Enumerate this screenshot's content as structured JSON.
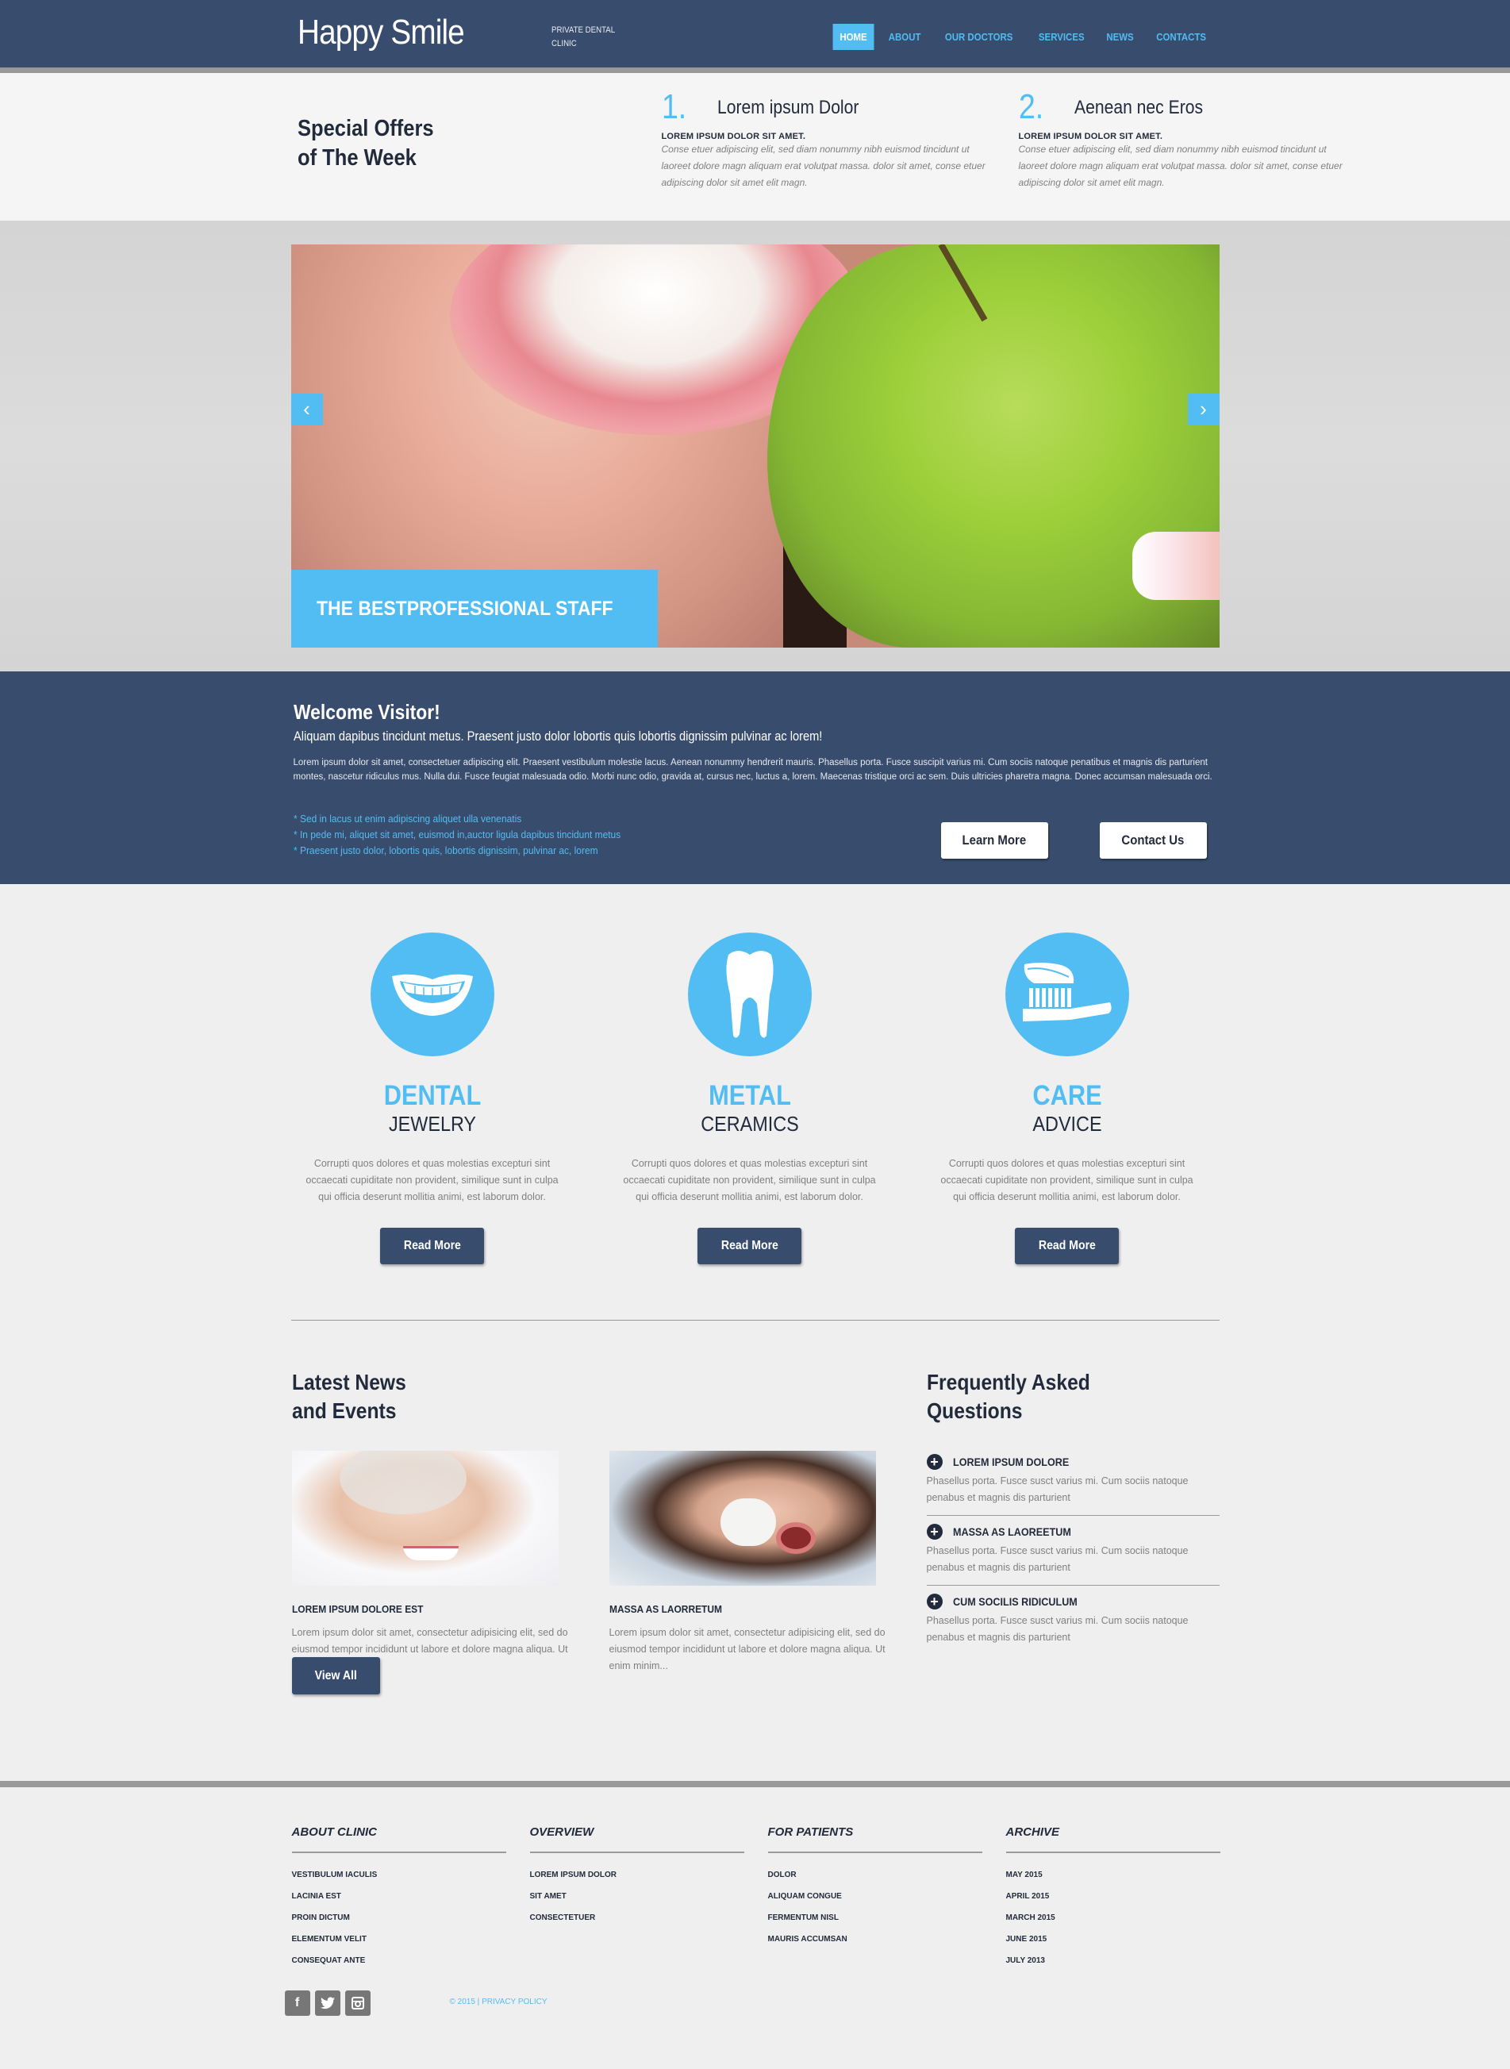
{
  "header": {
    "logo": "Happy Smile",
    "tagline": "PRIVATE DENTAL CLINIC",
    "nav": [
      {
        "label": "HOME",
        "active": true
      },
      {
        "label": "ABOUT"
      },
      {
        "label": "OUR DOCTORS"
      },
      {
        "label": "SERVICES"
      },
      {
        "label": "NEWS"
      },
      {
        "label": "CONTACTS"
      }
    ]
  },
  "offers": {
    "title_line1": "Special Offers",
    "title_line2": "of The Week",
    "items": [
      {
        "number": "1.",
        "title": "Lorem ipsum Dolor",
        "subtitle": "LOREM IPSUM DOLOR SIT AMET.",
        "text": "Conse etuer adipiscing elit, sed diam nonummy nibh euismod tincidunt ut laoreet dolore magn aliquam erat volutpat massa. dolor sit amet, conse etuer adipiscing dolor sit amet elit magn."
      },
      {
        "number": "2.",
        "title": "Aenean nec Eros",
        "subtitle": "LOREM IPSUM DOLOR SIT AMET.",
        "text": "Conse etuer adipiscing elit, sed diam nonummy nibh euismod tincidunt ut laoreet dolore magn aliquam erat volutpat massa. dolor sit amet, conse etuer adipiscing dolor sit amet elit magn."
      }
    ]
  },
  "slider": {
    "caption": "THE BESTPROFESSIONAL STAFF",
    "prev_icon": "chevron-left-icon",
    "next_icon": "chevron-right-icon"
  },
  "welcome": {
    "title": "Welcome Visitor!",
    "lead": "Aliquam dapibus tincidunt metus. Praesent justo dolor lobortis quis lobortis dignissim pulvinar ac lorem!",
    "body": "Lorem ipsum dolor sit amet, consectetuer adipiscing elit. Praesent vestibulum molestie lacus. Aenean nonummy hendrerit mauris. Phasellus porta. Fusce suscipit varius mi. Cum sociis natoque penatibus et magnis dis parturient montes, nascetur ridiculus mus. Nulla dui. Fusce feugiat malesuada odio. Morbi nunc odio, gravida at, cursus nec, luctus a, lorem. Maecenas tristique orci ac sem. Duis ultricies pharetra magna. Donec accumsan malesuada orci.",
    "bullets": [
      "* Sed in lacus ut enim adipiscing aliquet ulla venenatis",
      "* In pede mi, aliquet sit amet, euismod in,auctor ligula dapibus tincidunt metus",
      "* Praesent justo dolor, lobortis quis, lobortis dignissim, pulvinar ac, lorem"
    ],
    "learn_more": "Learn More",
    "contact_us": "Contact Us"
  },
  "services": [
    {
      "icon": "smile-icon",
      "title": "DENTAL",
      "subtitle": "JEWELRY",
      "text": "Corrupti quos dolores et quas molestias excepturi sint occaecati cupiditate non provident, similique sunt in culpa qui officia deserunt mollitia animi, est laborum dolor.",
      "button": "Read More"
    },
    {
      "icon": "tooth-icon",
      "title": "METAL",
      "subtitle": "CERAMICS",
      "text": "Corrupti quos dolores et quas molestias excepturi sint occaecati cupiditate non provident, similique sunt in culpa qui officia deserunt mollitia animi, est laborum dolor.",
      "button": "Read More"
    },
    {
      "icon": "toothbrush-icon",
      "title": "CARE",
      "subtitle": "ADVICE",
      "text": "Corrupti quos dolores et quas molestias excepturi sint occaecati cupiditate non provident, similique sunt in culpa qui officia deserunt mollitia animi, est laborum dolor.",
      "button": "Read More"
    }
  ],
  "news": {
    "title_line1": "Latest News",
    "title_line2": "and Events",
    "items": [
      {
        "title": "LOREM IPSUM DOLORE EST",
        "text": "Lorem ipsum dolor sit amet, consectetur adipisicing elit, sed do eiusmod tempor incididunt ut labore et dolore magna aliqua. Ut enim minim..."
      },
      {
        "title": "MASSA AS LAORRETUM",
        "text": "Lorem ipsum dolor sit amet, consectetur adipisicing elit, sed do eiusmod tempor incididunt ut labore et dolore magna aliqua. Ut enim minim..."
      }
    ],
    "view_all": "View All"
  },
  "faq": {
    "title_line1": "Frequently Asked",
    "title_line2": "Questions",
    "items": [
      {
        "q": "LOREM IPSUM DOLORE",
        "a": "Phasellus porta. Fusce susct varius mi. Cum sociis natoque penabus et magnis dis parturient"
      },
      {
        "q": "MASSA AS LAOREETUM",
        "a": "Phasellus porta. Fusce susct varius mi. Cum sociis natoque penabus et magnis dis parturient"
      },
      {
        "q": "CUM SOCILIS RIDICULUM",
        "a": "Phasellus porta. Fusce susct varius mi. Cum sociis natoque penabus et magnis dis parturient"
      }
    ]
  },
  "footer": {
    "columns": [
      {
        "title": "ABOUT CLINIC",
        "links": [
          "VESTIBULUM IACULIS",
          "LACINIA EST",
          "PROIN DICTUM",
          "ELEMENTUM VELIT",
          "CONSEQUAT ANTE"
        ]
      },
      {
        "title": "OVERVIEW",
        "links": [
          "LOREM IPSUM DOLOR",
          "SIT AMET",
          "CONSECTETUER"
        ]
      },
      {
        "title": "FOR PATIENTS",
        "links": [
          "DOLOR",
          "ALIQUAM CONGUE",
          "FERMENTUM NISL",
          "MAURIS ACCUMSAN"
        ]
      },
      {
        "title": "ARCHIVE",
        "links": [
          "MAY 2015",
          "APRIL 2015",
          "MARCH 2015",
          "JUNE 2015",
          "JULY 2013"
        ]
      }
    ],
    "social": [
      {
        "icon": "facebook-icon",
        "glyph": "f"
      },
      {
        "icon": "twitter-icon",
        "glyph": "t"
      },
      {
        "icon": "instagram-icon",
        "glyph": "◙"
      }
    ],
    "copyright": "© 2015 |",
    "privacy": "PRIVACY POLICY"
  },
  "colors": {
    "primary": "#384c6d",
    "accent": "#52bdf2",
    "text_dark": "#222b3c",
    "text_muted": "#808080",
    "background": "#efefef"
  }
}
